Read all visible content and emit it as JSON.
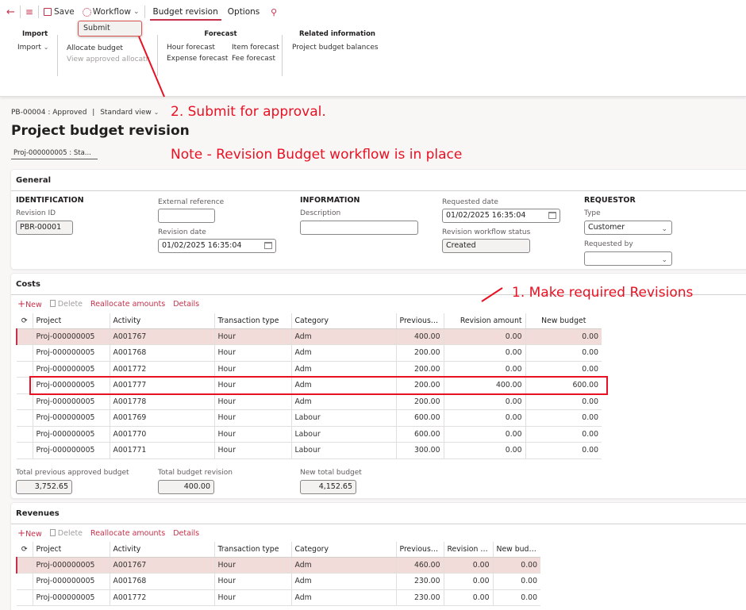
{
  "toolbar": {
    "back_icon": "back-arrow-icon",
    "menu_icon": "hamburger-icon",
    "save_label": "Save",
    "workflow_label": "Workflow",
    "tabs": [
      "Budget revision",
      "Options"
    ],
    "active_tab": "Budget revision",
    "search_icon": "search-icon",
    "workflow_menu": {
      "items": [
        "Submit"
      ]
    }
  },
  "ribbon": {
    "import": {
      "title": "Import",
      "items": [
        "Import"
      ]
    },
    "allocate": {
      "items": [
        "Allocate budget",
        "View approved allocatio"
      ]
    },
    "forecast": {
      "title": "Forecast",
      "items": [
        "Hour forecast",
        "Item forecast",
        "Expense forecast",
        "Fee forecast"
      ]
    },
    "related": {
      "title": "Related information",
      "items": [
        "Project budget balances"
      ]
    }
  },
  "annotations": {
    "step2": "2. Submit for approval.",
    "note": "Note - Revision Budget workflow is in place",
    "step1": "1. Make required Revisions"
  },
  "header": {
    "breadcrumb_record": "PB-00004 : Approved",
    "breadcrumb_sep": "|",
    "view": "Standard view",
    "title": "Project budget revision",
    "subfield": "Proj-000000005 : Sta..."
  },
  "general": {
    "title": "General",
    "identification": {
      "heading": "IDENTIFICATION",
      "revision_id_label": "Revision ID",
      "revision_id": "PBR-00001"
    },
    "external_reference_label": "External reference",
    "external_reference": "",
    "revision_date_label": "Revision date",
    "revision_date": "01/02/2025 16:35:04",
    "information": {
      "heading": "INFORMATION",
      "description_label": "Description",
      "description": ""
    },
    "requested_date_label": "Requested date",
    "requested_date": "01/02/2025 16:35:04",
    "workflow_status_label": "Revision workflow status",
    "workflow_status": "Created",
    "requestor": {
      "heading": "REQUESTOR",
      "type_label": "Type",
      "type": "Customer",
      "requested_by_label": "Requested by",
      "requested_by": ""
    }
  },
  "costs": {
    "title": "Costs",
    "actions": {
      "new": "New",
      "delete": "Delete",
      "reallocate": "Reallocate amounts",
      "details": "Details"
    },
    "columns": [
      "Project",
      "Activity",
      "Transaction type",
      "Category",
      "Previous a...",
      "Revision amount",
      "New budget"
    ],
    "rows": [
      [
        "Proj-000000005",
        "A001767",
        "Hour",
        "Adm",
        "400.00",
        "0.00",
        "0.00"
      ],
      [
        "Proj-000000005",
        "A001768",
        "Hour",
        "Adm",
        "200.00",
        "0.00",
        "0.00"
      ],
      [
        "Proj-000000005",
        "A001772",
        "Hour",
        "Adm",
        "200.00",
        "0.00",
        "0.00"
      ],
      [
        "Proj-000000005",
        "A001777",
        "Hour",
        "Adm",
        "200.00",
        "400.00",
        "600.00"
      ],
      [
        "Proj-000000005",
        "A001778",
        "Hour",
        "Adm",
        "200.00",
        "0.00",
        "0.00"
      ],
      [
        "Proj-000000005",
        "A001769",
        "Hour",
        "Labour",
        "600.00",
        "0.00",
        "0.00"
      ],
      [
        "Proj-000000005",
        "A001770",
        "Hour",
        "Labour",
        "600.00",
        "0.00",
        "0.00"
      ],
      [
        "Proj-000000005",
        "A001771",
        "Hour",
        "Labour",
        "300.00",
        "0.00",
        "0.00"
      ]
    ],
    "totals": {
      "prev_label": "Total previous approved budget",
      "prev": "3,752.65",
      "revision_label": "Total budget revision",
      "revision": "400.00",
      "new_label": "New total budget",
      "new": "4,152.65"
    }
  },
  "revenues": {
    "title": "Revenues",
    "actions": {
      "new": "New",
      "delete": "Delete",
      "reallocate": "Reallocate amounts",
      "details": "Details"
    },
    "columns": [
      "Project",
      "Activity",
      "Transaction type",
      "Category",
      "Previous a...",
      "Revision a...",
      "New budget"
    ],
    "rows": [
      [
        "Proj-000000005",
        "A001767",
        "Hour",
        "Adm",
        "460.00",
        "0.00",
        "0.00"
      ],
      [
        "Proj-000000005",
        "A001768",
        "Hour",
        "Adm",
        "230.00",
        "0.00",
        "0.00"
      ],
      [
        "Proj-000000005",
        "A001772",
        "Hour",
        "Adm",
        "230.00",
        "0.00",
        "0.00"
      ]
    ]
  },
  "colors": {
    "accent": "#c4314b",
    "annotation": "#e81123",
    "selected_row": "#f2dcda"
  }
}
